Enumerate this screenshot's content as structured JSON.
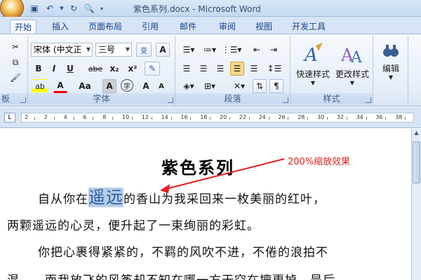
{
  "window": {
    "title": "紫色系列.docx - Microsoft Word",
    "qat": [
      "save-icon",
      "undo-icon",
      "redo-icon",
      "print-preview-icon",
      "customize-icon"
    ]
  },
  "tabs": [
    "开始",
    "插入",
    "页面布局",
    "引用",
    "邮件",
    "审阅",
    "视图",
    "开发工具"
  ],
  "active_tab": "开始",
  "ribbon": {
    "clipboard": {
      "label": "板"
    },
    "font": {
      "label": "字体",
      "font_name": "宋体 (中文正",
      "font_size": "三号",
      "bold": "B",
      "italic": "I",
      "underline": "U",
      "strike": "abe",
      "subscript": "x₂",
      "superscript": "x²",
      "text_highlight": "ab",
      "font_color": "A",
      "change_case": "Aa",
      "char_shading": "A",
      "enclose": "字",
      "grow": "A",
      "shrink": "A"
    },
    "paragraph": {
      "label": "段落"
    },
    "styles": {
      "label": "样式",
      "quick_styles": "快速样式",
      "change_styles": "更改样式"
    },
    "editing": {
      "label": "编辑"
    }
  },
  "ruler": {
    "numbers": [
      "2",
      "2",
      "4",
      "6",
      "8",
      "10",
      "12",
      "14",
      "16",
      "18",
      "20",
      "22",
      "24",
      "26",
      "28",
      "30",
      "32",
      "34",
      "36",
      "38"
    ]
  },
  "document": {
    "title": "紫色系列",
    "annotation": "200%缩放效果",
    "p1_before": "自从你在",
    "p1_highlight": "遥远",
    "p1_after": "的香山为我采回来一枚美丽的红叶，",
    "p1_line2": "两颗遥远的心灵，便升起了一束绚丽的彩虹。",
    "p2_line1": "你把心裹得紧紧的，不羁的风吹不进，不倦的浪拍不",
    "p2_line2": "混……而我放飞的风筝却不知在哪一方天空在擅更掉，是后"
  },
  "colors": {
    "accent": "#15428b",
    "annotation": "#e11d1d",
    "highlight": "#b6cde8"
  }
}
